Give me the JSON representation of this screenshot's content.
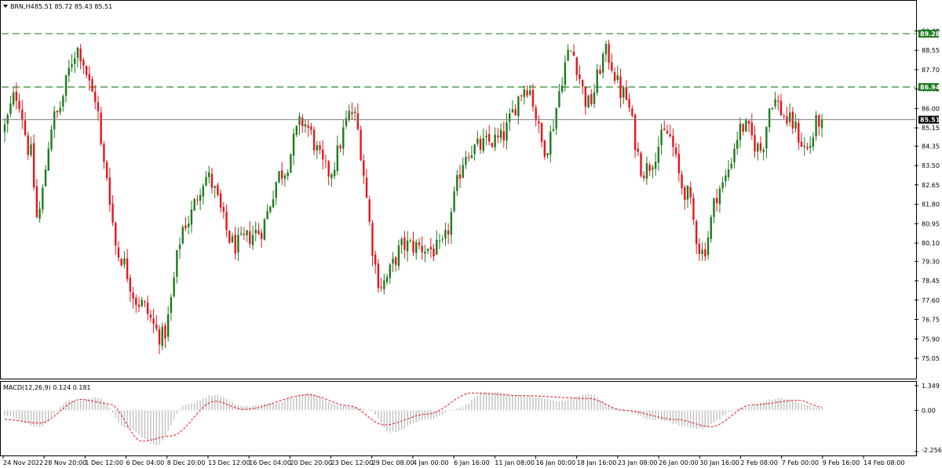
{
  "header": {
    "symbol": "BRN,H4",
    "ohlc": "85.51 85.72 85.43 85.51"
  },
  "macd_label": "MACD(12,26,9) 0.124 0.181",
  "colors": {
    "bull": "#1e7b1e",
    "bear": "#e8141c",
    "level_line": "#2b8a2b",
    "signal": "#e8141c",
    "histogram": "#c0c0c0",
    "bid_line": "#808080",
    "bid_tag": "#000000",
    "level_tag": "#1e7b1e"
  },
  "chart_data": [
    {
      "type": "candlestick",
      "title": "BRN,H4",
      "ylim": [
        75.05,
        90.0
      ],
      "y_ticks": [
        "89.40",
        "88.55",
        "87.70",
        "86.85",
        "86.00",
        "85.15",
        "84.35",
        "83.50",
        "82.65",
        "81.80",
        "80.95",
        "80.10",
        "79.30",
        "78.45",
        "77.60",
        "76.75",
        "75.90",
        "75.05"
      ],
      "x_ticks": [
        "24 Nov 2022",
        "28 Nov 20:00",
        "1 Dec 12:00",
        "6 Dec 04:00",
        "8 Dec 20:00",
        "13 Dec 12:00",
        "16 Dec 04:00",
        "20 Dec 20:00",
        "23 Dec 12:00",
        "29 Dec 08:00",
        "4 Jan 00:00",
        "6 Jan 16:00",
        "11 Jan 08:00",
        "16 Jan 00:00",
        "18 Jan 16:00",
        "23 Jan 08:00",
        "26 Jan 00:00",
        "30 Jan 16:00",
        "2 Feb 08:00",
        "7 Feb 00:00",
        "9 Feb 16:00",
        "14 Feb 08:00"
      ],
      "levels": [
        {
          "label": "89.28",
          "value": 89.28
        },
        {
          "label": "86.94",
          "value": 86.94
        }
      ],
      "bid": {
        "label": "85.51",
        "value": 85.51
      },
      "waypoints": [
        {
          "i": 0,
          "v": 85.0
        },
        {
          "i": 5,
          "v": 86.6
        },
        {
          "i": 10,
          "v": 84.0
        },
        {
          "i": 12,
          "v": 81.2
        },
        {
          "i": 18,
          "v": 85.6
        },
        {
          "i": 26,
          "v": 88.6
        },
        {
          "i": 32,
          "v": 86.5
        },
        {
          "i": 35,
          "v": 83.5
        },
        {
          "i": 40,
          "v": 79.6
        },
        {
          "i": 47,
          "v": 77.5
        },
        {
          "i": 55,
          "v": 76.0
        },
        {
          "i": 63,
          "v": 81.0
        },
        {
          "i": 70,
          "v": 83.0
        },
        {
          "i": 80,
          "v": 80.0
        },
        {
          "i": 88,
          "v": 80.6
        },
        {
          "i": 96,
          "v": 83.2
        },
        {
          "i": 103,
          "v": 85.4
        },
        {
          "i": 112,
          "v": 83.2
        },
        {
          "i": 120,
          "v": 85.8
        },
        {
          "i": 130,
          "v": 78.3
        },
        {
          "i": 138,
          "v": 80.0
        },
        {
          "i": 150,
          "v": 79.8
        },
        {
          "i": 160,
          "v": 84.2
        },
        {
          "i": 170,
          "v": 84.6
        },
        {
          "i": 180,
          "v": 87.0
        },
        {
          "i": 186,
          "v": 84.3
        },
        {
          "i": 195,
          "v": 88.5
        },
        {
          "i": 201,
          "v": 86.2
        },
        {
          "i": 207,
          "v": 88.4
        },
        {
          "i": 213,
          "v": 86.6
        },
        {
          "i": 220,
          "v": 83.3
        },
        {
          "i": 228,
          "v": 84.9
        },
        {
          "i": 234,
          "v": 82.4
        },
        {
          "i": 240,
          "v": 79.7
        },
        {
          "i": 246,
          "v": 82.5
        },
        {
          "i": 254,
          "v": 85.2
        },
        {
          "i": 260,
          "v": 84.2
        },
        {
          "i": 264,
          "v": 86.4
        },
        {
          "i": 270,
          "v": 85.4
        },
        {
          "i": 276,
          "v": 84.2
        },
        {
          "i": 280,
          "v": 85.5
        }
      ]
    },
    {
      "type": "histogram+line",
      "title": "MACD(12,26,9) 0.124 0.181",
      "ylim": [
        -2.256,
        1.349
      ],
      "y_ticks": [
        "1.349",
        "0.00",
        "-2.256"
      ],
      "macd_waypoints": [
        {
          "i": 0,
          "v": -0.3
        },
        {
          "i": 12,
          "v": -0.9
        },
        {
          "i": 22,
          "v": 0.5
        },
        {
          "i": 32,
          "v": 0.7
        },
        {
          "i": 42,
          "v": -1.0
        },
        {
          "i": 52,
          "v": -1.9
        },
        {
          "i": 62,
          "v": 0.3
        },
        {
          "i": 72,
          "v": 0.85
        },
        {
          "i": 82,
          "v": 0.2
        },
        {
          "i": 92,
          "v": 0.4
        },
        {
          "i": 104,
          "v": 0.9
        },
        {
          "i": 115,
          "v": 0.3
        },
        {
          "i": 125,
          "v": 0.05
        },
        {
          "i": 132,
          "v": -1.2
        },
        {
          "i": 145,
          "v": -0.5
        },
        {
          "i": 155,
          "v": 0.1
        },
        {
          "i": 165,
          "v": 1.0
        },
        {
          "i": 178,
          "v": 0.8
        },
        {
          "i": 190,
          "v": 0.5
        },
        {
          "i": 200,
          "v": 0.9
        },
        {
          "i": 210,
          "v": 0.1
        },
        {
          "i": 222,
          "v": -0.5
        },
        {
          "i": 238,
          "v": -1.0
        },
        {
          "i": 252,
          "v": 0.1
        },
        {
          "i": 265,
          "v": 0.65
        },
        {
          "i": 280,
          "v": 0.124
        }
      ],
      "signal_waypoints": [
        {
          "i": 0,
          "v": -0.5
        },
        {
          "i": 12,
          "v": -0.7
        },
        {
          "i": 26,
          "v": 0.6
        },
        {
          "i": 36,
          "v": 0.35
        },
        {
          "i": 47,
          "v": -1.7
        },
        {
          "i": 57,
          "v": -1.4
        },
        {
          "i": 72,
          "v": 0.5
        },
        {
          "i": 82,
          "v": 0.05
        },
        {
          "i": 104,
          "v": 0.85
        },
        {
          "i": 118,
          "v": 0.25
        },
        {
          "i": 130,
          "v": -0.8
        },
        {
          "i": 145,
          "v": -0.2
        },
        {
          "i": 160,
          "v": 0.95
        },
        {
          "i": 178,
          "v": 0.8
        },
        {
          "i": 200,
          "v": 0.65
        },
        {
          "i": 212,
          "v": 0.0
        },
        {
          "i": 230,
          "v": -0.5
        },
        {
          "i": 242,
          "v": -0.9
        },
        {
          "i": 256,
          "v": 0.3
        },
        {
          "i": 272,
          "v": 0.55
        },
        {
          "i": 280,
          "v": 0.181
        }
      ]
    }
  ]
}
